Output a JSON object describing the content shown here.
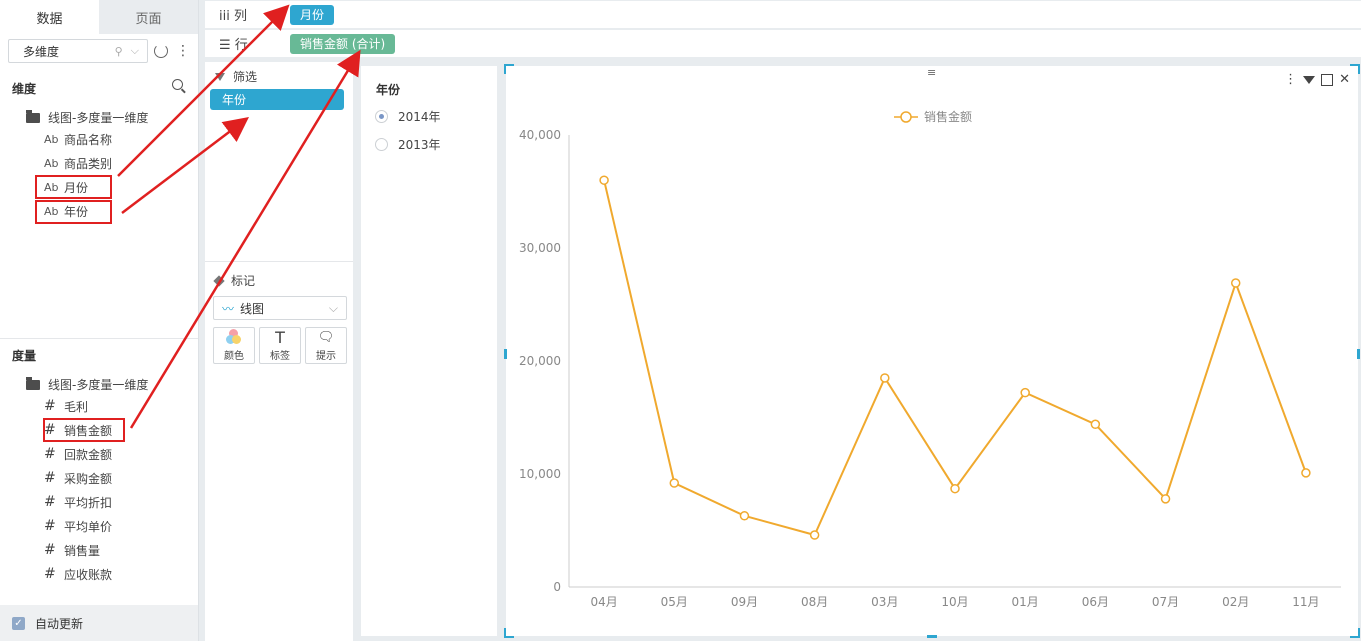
{
  "left_panel": {
    "tabs": [
      "数据",
      "页面"
    ],
    "select_value": "多维度",
    "dimension_title": "维度",
    "dimension_folder": "线图-多度量一维度",
    "dimensions": [
      "商品名称",
      "商品类别",
      "月份",
      "年份"
    ],
    "measure_title": "度量",
    "measure_folder": "线图-多度量一维度",
    "measures": [
      "毛利",
      "销售金额",
      "回款金额",
      "采购金额",
      "平均折扣",
      "平均单价",
      "销售量",
      "应收账款"
    ],
    "auto_update": "自动更新",
    "dim_icon": "Ab",
    "measure_icon": "#"
  },
  "shelves": {
    "columns_label": "列",
    "columns_pill": "月份",
    "rows_label": "行",
    "rows_pill": "销售金额 (合计)"
  },
  "filter_panel": {
    "title": "筛选",
    "pill": "年份",
    "mark_title": "标记",
    "chart_type": "线图",
    "buttons": [
      "颜色",
      "标签",
      "提示"
    ]
  },
  "filter_values": {
    "title": "年份",
    "options": [
      "2014年",
      "2013年"
    ],
    "selected": 0
  },
  "chart_data": {
    "type": "line",
    "legend": "销售金额",
    "categories": [
      "04月",
      "05月",
      "09月",
      "08月",
      "03月",
      "10月",
      "01月",
      "06月",
      "07月",
      "02月",
      "11月"
    ],
    "series": [
      {
        "name": "销售金额",
        "values": [
          36000,
          9200,
          6300,
          4600,
          18500,
          8700,
          17200,
          14400,
          7800,
          26900,
          10100
        ]
      }
    ],
    "yticks": [
      "0",
      "10,000",
      "20,000",
      "30,000",
      "40,000"
    ],
    "ylim": [
      0,
      40000
    ],
    "line_color": "#f0a92e"
  }
}
